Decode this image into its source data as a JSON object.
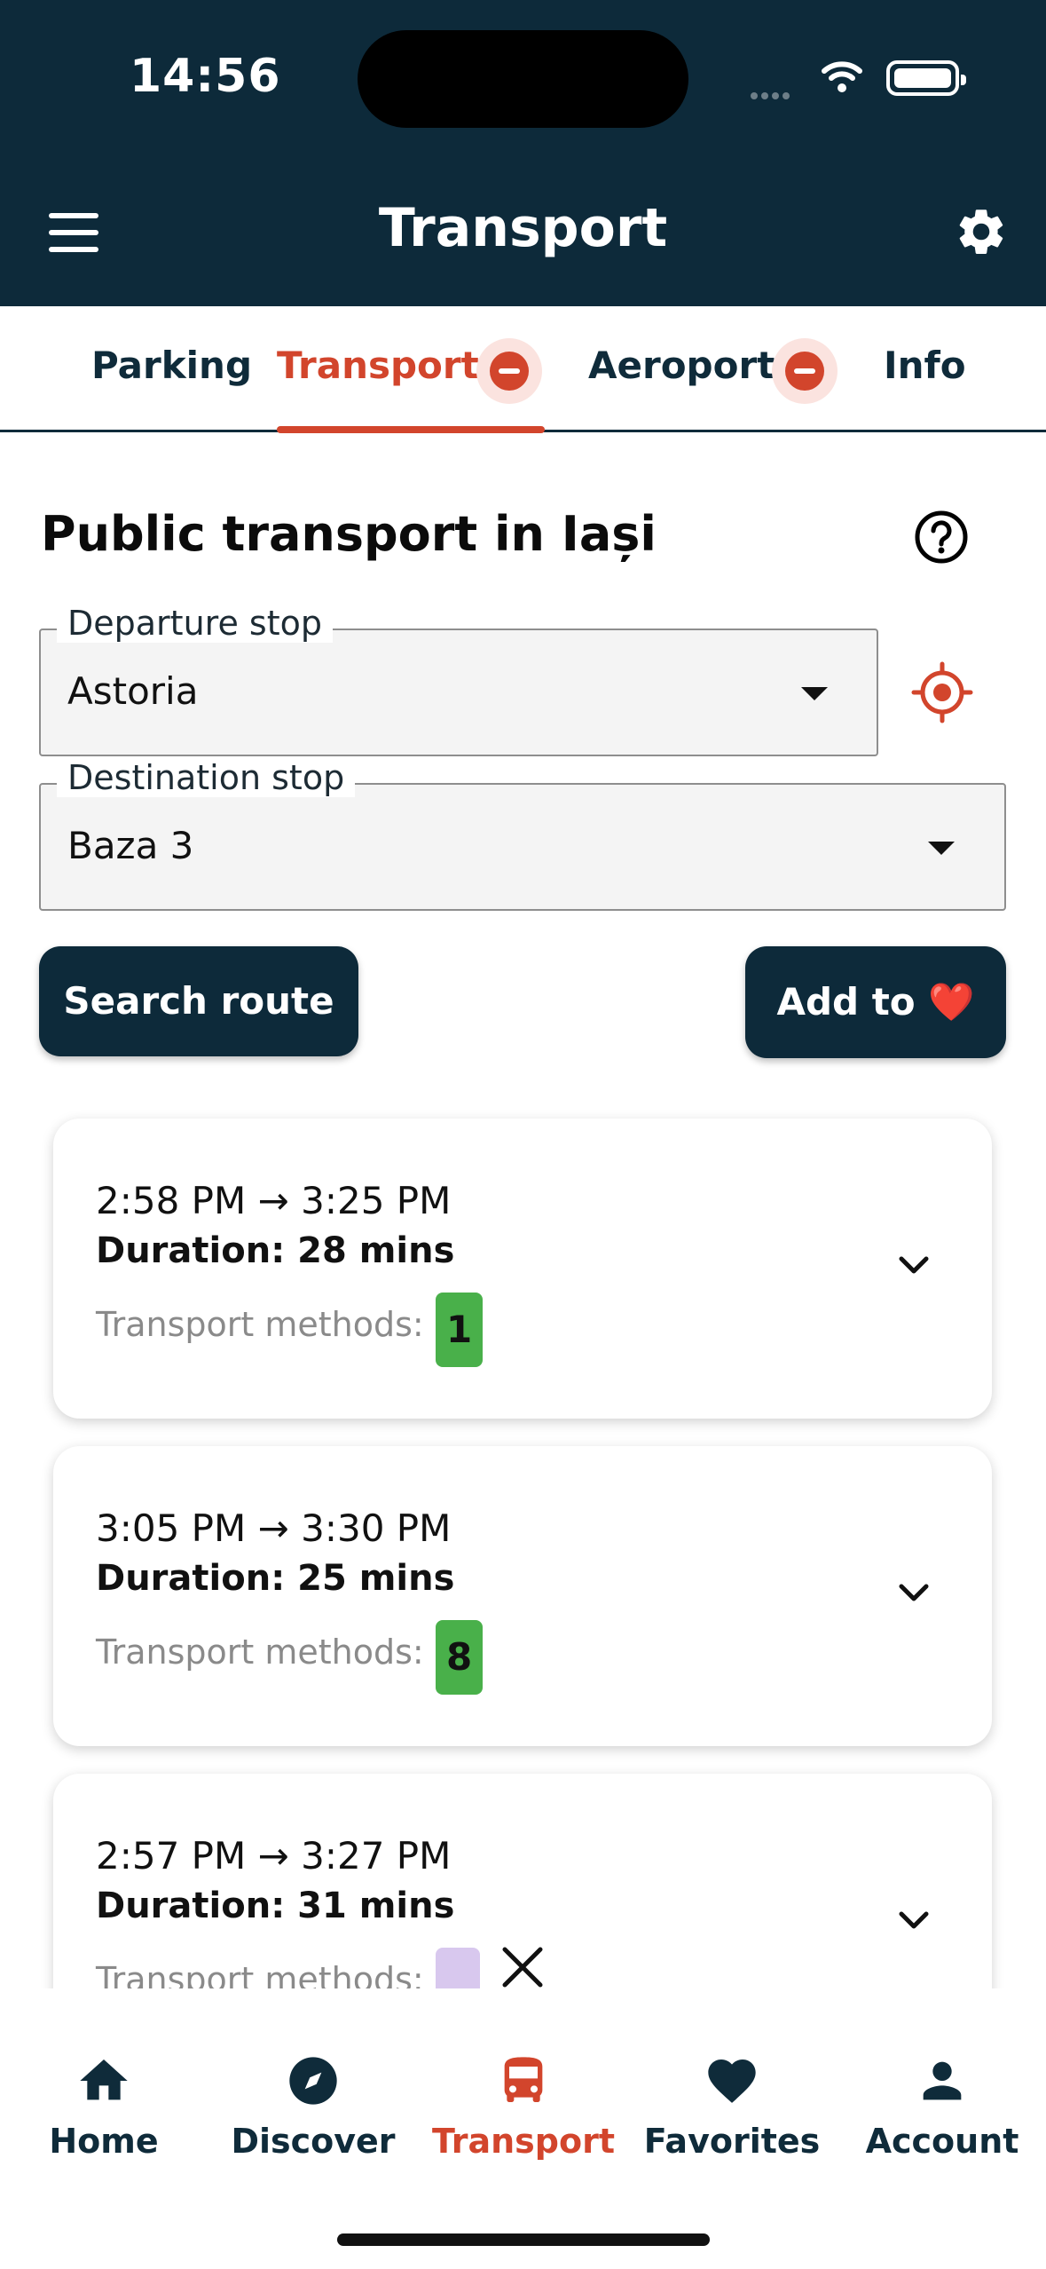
{
  "status_bar": {
    "time": "14:56"
  },
  "header": {
    "title": "Transport"
  },
  "tabs": [
    {
      "label": "Parking",
      "active": false,
      "removable": false
    },
    {
      "label": "Transport",
      "active": true,
      "removable": true
    },
    {
      "label": "Aeroport",
      "active": false,
      "removable": true
    },
    {
      "label": "Info",
      "active": false,
      "removable": false
    }
  ],
  "section": {
    "title": "Public transport in Iași"
  },
  "departure": {
    "label": "Departure stop",
    "value": "Astoria"
  },
  "destination": {
    "label": "Destination stop",
    "value": "Baza 3"
  },
  "actions": {
    "search_label": "Search route",
    "add_label": "Add to ❤️"
  },
  "routes": [
    {
      "times": "2:58 PM → 3:25 PM",
      "duration": "Duration: 28 mins",
      "methods_label": "Transport methods:",
      "badge": "1"
    },
    {
      "times": "3:05 PM → 3:30 PM",
      "duration": "Duration: 25 mins",
      "methods_label": "Transport methods:",
      "badge": "8"
    },
    {
      "times": "2:57 PM → 3:27 PM",
      "duration": "Duration: 31 mins",
      "methods_label": "Transport methods:",
      "badge": ""
    }
  ],
  "bottom_nav": [
    {
      "label": "Home",
      "icon": "home-icon",
      "active": false
    },
    {
      "label": "Discover",
      "icon": "compass-icon",
      "active": false
    },
    {
      "label": "Transport",
      "icon": "bus-icon",
      "active": true
    },
    {
      "label": "Favorites",
      "icon": "heart-icon",
      "active": false
    },
    {
      "label": "Account",
      "icon": "person-icon",
      "active": false
    }
  ],
  "colors": {
    "header_bg": "#0d2a3a",
    "accent": "#d2452c",
    "badge_green": "#49b04a"
  }
}
